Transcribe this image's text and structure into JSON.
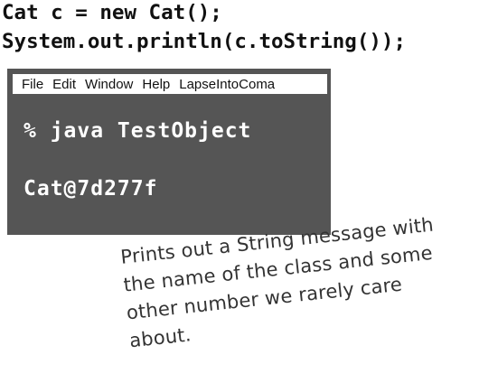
{
  "code": {
    "line1": "Cat c = new Cat();",
    "line2": "System.out.println(c.toString());"
  },
  "terminal": {
    "menu": [
      "File",
      "Edit",
      "Window",
      "Help",
      "LapseIntoComa"
    ],
    "command": "% java TestObject",
    "output": "Cat@7d277f",
    "background": "#555555",
    "text_color": "#ffffff"
  },
  "annotation": {
    "lines": [
      "Prints out a String message with",
      "the name of the class and some",
      "other number we rarely care",
      "about."
    ]
  }
}
